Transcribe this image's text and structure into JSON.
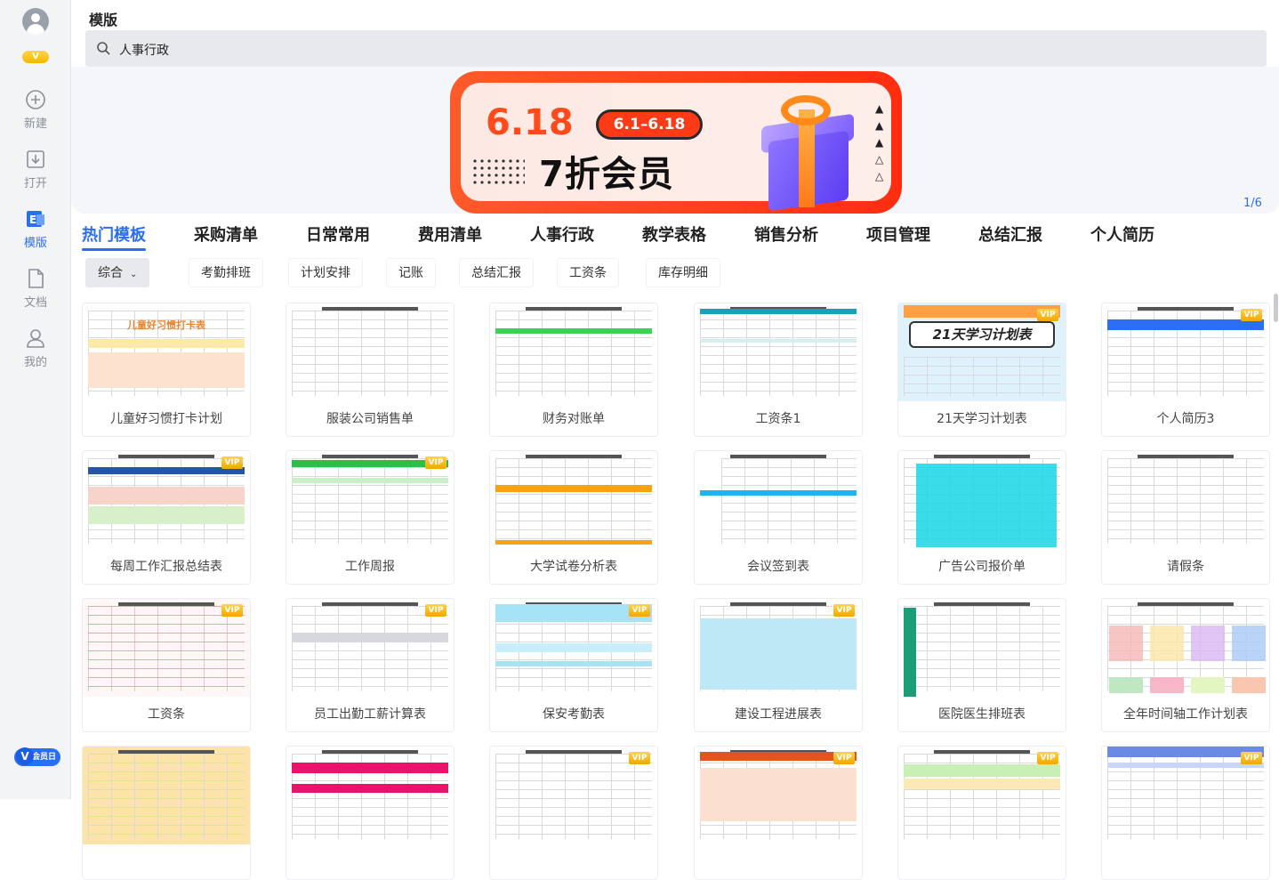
{
  "sidebar": {
    "vip_badge": "V",
    "items": [
      {
        "label": "新建",
        "icon": "plus-circle-icon"
      },
      {
        "label": "打开",
        "icon": "download-box-icon"
      },
      {
        "label": "模版",
        "icon": "template-e-icon"
      },
      {
        "label": "文档",
        "icon": "document-icon"
      },
      {
        "label": "我的",
        "icon": "person-icon"
      }
    ],
    "member_day_v": "V",
    "member_day": "会员日"
  },
  "header": {
    "title": "模版",
    "search_value": "人事行政"
  },
  "banner": {
    "big_number": "6.18",
    "date_range": "6.1–6.18",
    "headline": "7折会员",
    "counter": "1/6"
  },
  "tabs": [
    "热门模板",
    "采购清单",
    "日常常用",
    "费用清单",
    "人事行政",
    "教学表格",
    "销售分析",
    "项目管理",
    "总结汇报",
    "个人简历"
  ],
  "filters": [
    "综合",
    "考勤排班",
    "计划安排",
    "记账",
    "总结汇报",
    "工资条",
    "库存明细"
  ],
  "vip_label": "VIP",
  "cards": [
    {
      "title": "儿童好习惯打卡计划",
      "vip": false,
      "style": "kids",
      "thumb_text": "儿童好习惯打卡表"
    },
    {
      "title": "服装公司销售单",
      "vip": false,
      "style": "plain"
    },
    {
      "title": "财务对账单",
      "vip": false,
      "style": "green"
    },
    {
      "title": "工资条1",
      "vip": false,
      "style": "teal"
    },
    {
      "title": "21天学习计划表",
      "vip": true,
      "style": "study",
      "thumb_text": "21天学习计划表"
    },
    {
      "title": "个人简历3",
      "vip": true,
      "style": "resume"
    },
    {
      "title": "每周工作汇报总结表",
      "vip": true,
      "style": "weekly"
    },
    {
      "title": "工作周报",
      "vip": true,
      "style": "greenbar"
    },
    {
      "title": "大学试卷分析表",
      "vip": false,
      "style": "orange"
    },
    {
      "title": "会议签到表",
      "vip": false,
      "style": "cyan"
    },
    {
      "title": "广告公司报价单",
      "vip": false,
      "style": "cyanfill"
    },
    {
      "title": "请假条",
      "vip": false,
      "style": "plain"
    },
    {
      "title": "工资条",
      "vip": true,
      "style": "red"
    },
    {
      "title": "员工出勤工薪计算表",
      "vip": true,
      "style": "gray"
    },
    {
      "title": "保安考勤表",
      "vip": true,
      "style": "lightblue"
    },
    {
      "title": "建设工程进展表",
      "vip": true,
      "style": "lightblue2"
    },
    {
      "title": "医院医生排班表",
      "vip": false,
      "style": "hospital"
    },
    {
      "title": "全年时间轴工作计划表",
      "vip": false,
      "style": "timeline"
    },
    {
      "title": "",
      "vip": false,
      "style": "kids2"
    },
    {
      "title": "",
      "vip": false,
      "style": "pink"
    },
    {
      "title": "",
      "vip": true,
      "style": "plain"
    },
    {
      "title": "",
      "vip": true,
      "style": "orangebar"
    },
    {
      "title": "",
      "vip": true,
      "style": "colorful"
    },
    {
      "title": "",
      "vip": true,
      "style": "bluehead"
    }
  ],
  "colors": {
    "accent": "#2a6ef5",
    "banner_red": "#ff3b17",
    "vip_gold": "#f5b800"
  }
}
